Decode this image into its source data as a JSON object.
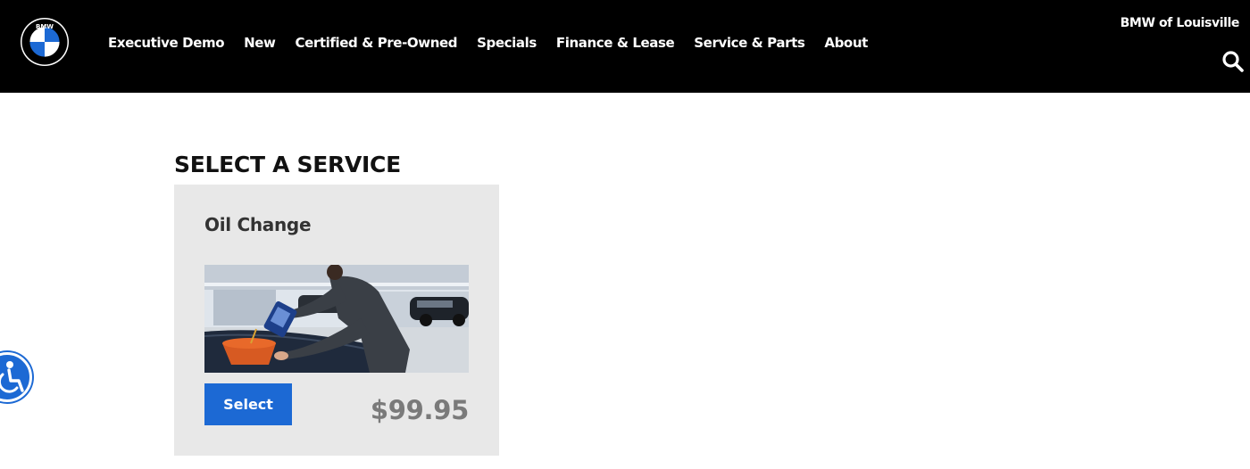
{
  "header": {
    "logo": {
      "icon": "bmw-roundel-icon",
      "text": "BMW"
    },
    "nav": [
      {
        "label": "Executive Demo"
      },
      {
        "label": "New"
      },
      {
        "label": "Certified & Pre-Owned"
      },
      {
        "label": "Specials"
      },
      {
        "label": "Finance & Lease"
      },
      {
        "label": "Service & Parts"
      },
      {
        "label": "About"
      }
    ],
    "dealer_name": "BMW of Louisville",
    "search_icon": "search-icon"
  },
  "main": {
    "section_title": "SELECT A SERVICE",
    "services": [
      {
        "title": "Oil Change",
        "image": "technician-pouring-oil-photo",
        "button_label": "Select",
        "price": "$99.95"
      }
    ]
  },
  "accessibility": {
    "icon": "accessibility-icon"
  },
  "colors": {
    "header_bg": "#000000",
    "card_bg": "#e8e8e8",
    "button_blue": "#1c69d4",
    "price_gray": "#7a7a7a"
  }
}
